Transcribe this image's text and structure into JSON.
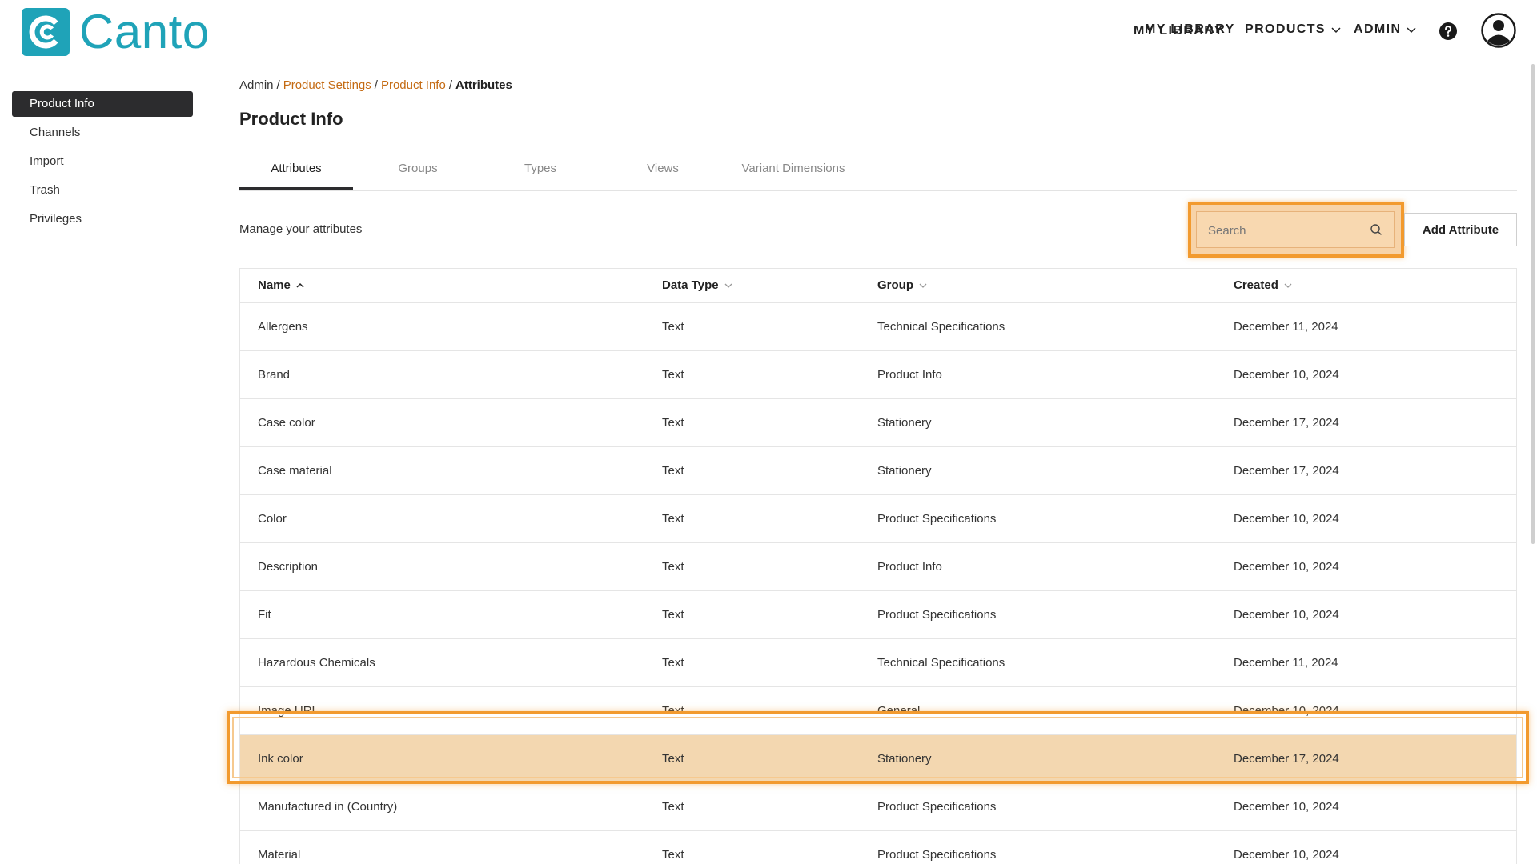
{
  "brand": {
    "name": "Canto",
    "color": "#1fa3b8"
  },
  "topnav": {
    "my_library": "MY LIBRARY",
    "products": "PRODUCTS",
    "admin": "ADMIN"
  },
  "sidebar": {
    "items": [
      {
        "label": "Product Info",
        "active": true
      },
      {
        "label": "Channels"
      },
      {
        "label": "Import"
      },
      {
        "label": "Trash"
      },
      {
        "label": "Privileges"
      }
    ]
  },
  "breadcrumb": {
    "admin": "Admin",
    "product_settings": "Product Settings",
    "product_info": "Product Info",
    "current": "Attributes",
    "separator": "/"
  },
  "page": {
    "title": "Product Info",
    "subtitle": "Manage your attributes"
  },
  "tabs": [
    "Attributes",
    "Groups",
    "Types",
    "Views",
    "Variant Dimensions"
  ],
  "search": {
    "placeholder": "Search"
  },
  "actions": {
    "add_attribute": "Add Attribute"
  },
  "table": {
    "headers": {
      "name": "Name",
      "data_type": "Data Type",
      "group": "Group",
      "created": "Created"
    },
    "rows": [
      {
        "name": "Allergens",
        "type": "Text",
        "group": "Technical Specifications",
        "created": "December 11, 2024"
      },
      {
        "name": "Brand",
        "type": "Text",
        "group": "Product Info",
        "created": "December 10, 2024"
      },
      {
        "name": "Case color",
        "type": "Text",
        "group": "Stationery",
        "created": "December 17, 2024"
      },
      {
        "name": "Case material",
        "type": "Text",
        "group": "Stationery",
        "created": "December 17, 2024"
      },
      {
        "name": "Color",
        "type": "Text",
        "group": "Product Specifications",
        "created": "December 10, 2024"
      },
      {
        "name": "Description",
        "type": "Text",
        "group": "Product Info",
        "created": "December 10, 2024"
      },
      {
        "name": "Fit",
        "type": "Text",
        "group": "Product Specifications",
        "created": "December 10, 2024"
      },
      {
        "name": "Hazardous Chemicals",
        "type": "Text",
        "group": "Technical Specifications",
        "created": "December 11, 2024"
      },
      {
        "name": "Image URL",
        "type": "Text",
        "group": "General",
        "created": "December 10, 2024"
      },
      {
        "name": "Ink color",
        "type": "Text",
        "group": "Stationery",
        "created": "December 17, 2024"
      },
      {
        "name": "Manufactured in (Country)",
        "type": "Text",
        "group": "Product Specifications",
        "created": "December 10, 2024"
      },
      {
        "name": "Material",
        "type": "Text",
        "group": "Product Specifications",
        "created": "December 10, 2024"
      }
    ]
  },
  "colors": {
    "accent_highlight": "#f29a2e",
    "link": "#c46a12",
    "active_bg": "#2c2c2e"
  }
}
